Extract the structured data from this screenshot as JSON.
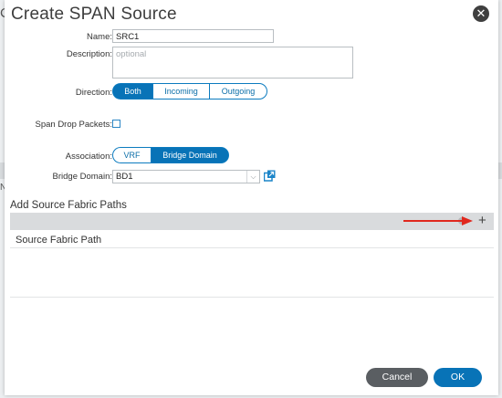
{
  "background": {
    "left_fragment": "C",
    "side_letter": "N"
  },
  "dialog": {
    "title": "Create SPAN Source",
    "close_icon": "close-icon"
  },
  "form": {
    "name": {
      "label": "Name:",
      "value": "SRC1"
    },
    "description": {
      "label": "Description:",
      "placeholder": "optional"
    },
    "direction": {
      "label": "Direction:",
      "options": [
        "Both",
        "Incoming",
        "Outgoing"
      ],
      "selected": "Both"
    },
    "span_drop": {
      "label": "Span Drop Packets:",
      "checked": false
    },
    "association": {
      "label": "Association:",
      "options": [
        "VRF",
        "Bridge Domain"
      ],
      "selected": "Bridge Domain"
    },
    "bridge_domain": {
      "label": "Bridge Domain:",
      "value": "BD1"
    }
  },
  "fabric_paths": {
    "title": "Add Source Fabric Paths",
    "column": "Source Fabric Path",
    "add_icon": "plus-icon"
  },
  "footer": {
    "cancel": "Cancel",
    "ok": "OK"
  },
  "colors": {
    "accent": "#0873b7",
    "arrow": "#e0281e",
    "cancel": "#5a5e62"
  }
}
